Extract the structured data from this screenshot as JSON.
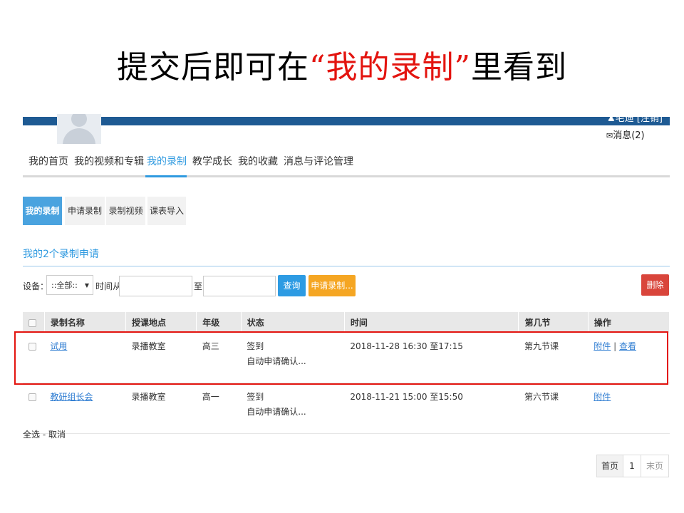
{
  "slide": {
    "title_prefix": "提交后即可在",
    "title_highlight": "“我的录制”",
    "title_suffix": "里看到",
    "highlight_color": "#e3140f"
  },
  "header": {
    "user_text": "毛迪 [注销]",
    "messages_icon": "envelope-icon",
    "messages_label": "消息(2)",
    "brand_color": "#1e5a93"
  },
  "main_nav": {
    "items": [
      "我的首页",
      "我的视频和专辑",
      "我的录制",
      "教学成长",
      "我的收藏",
      "消息与评论管理"
    ],
    "active": "我的录制"
  },
  "sub_tabs": {
    "items": [
      "我的录制",
      "申请录制",
      "录制视频",
      "课表导入"
    ],
    "active": "我的录制"
  },
  "section": {
    "title": "我的2个录制申请"
  },
  "filters": {
    "device_label": "设备：",
    "device_value": "::全部::",
    "time_from_label": "时间从",
    "time_to_label": "至",
    "time_from_value": "",
    "time_to_value": "",
    "query_button": "查询",
    "apply_button": "申请录制...",
    "delete_button": "删除"
  },
  "table": {
    "headers": [
      "录制名称",
      "授课地点",
      "年级",
      "状态",
      "时间",
      "第几节",
      "操作"
    ],
    "rows": [
      {
        "name": "试用",
        "location": "录播教室",
        "grade": "高三",
        "status1": "签到",
        "status2": "自动申请确认...",
        "time": "2018-11-28 16:30 至17:15",
        "period": "第九节课",
        "action1": "附件",
        "action_sep": "|",
        "action2": "查看"
      },
      {
        "name": "教研组长会",
        "location": "录播教室",
        "grade": "高一",
        "status1": "签到",
        "status2": "自动申请确认...",
        "time": "2018-11-21 15:00 至15:50",
        "period": "第六节课",
        "action1": "附件"
      }
    ]
  },
  "footer": {
    "select_all": "全选",
    "select_sep": " - ",
    "cancel": "取消"
  },
  "pagination": {
    "first": "首页",
    "current": "1",
    "last": "末页"
  }
}
